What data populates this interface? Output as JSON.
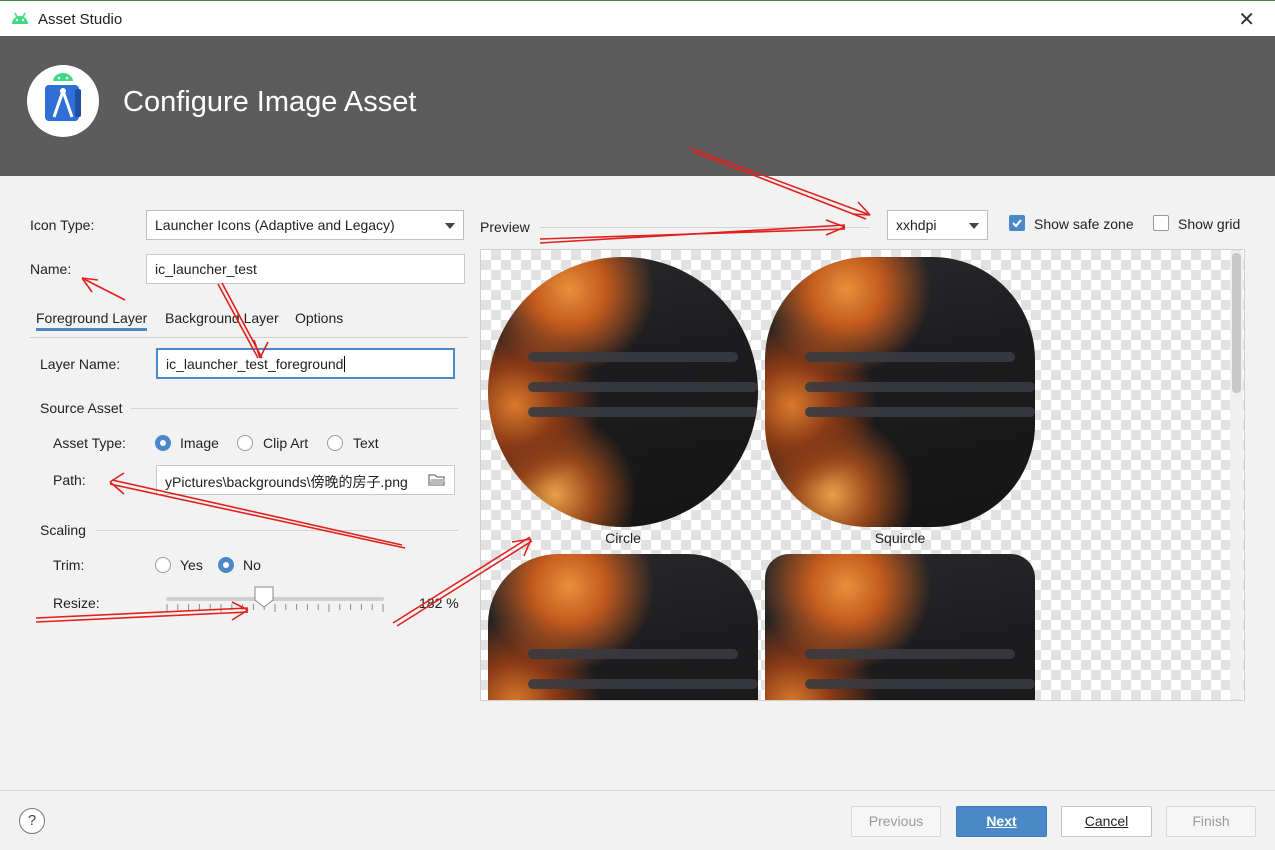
{
  "window": {
    "title": "Asset Studio"
  },
  "header": {
    "heading": "Configure Image Asset"
  },
  "form": {
    "icon_type_label": "Icon Type:",
    "icon_type_value": "Launcher Icons (Adaptive and Legacy)",
    "name_label": "Name:",
    "name_value": "ic_launcher_test",
    "tabs": [
      "Foreground Layer",
      "Background Layer",
      "Options"
    ],
    "layer_name_label": "Layer Name:",
    "layer_name_value": "ic_launcher_test_foreground",
    "source_asset_title": "Source Asset",
    "asset_type_label": "Asset Type:",
    "asset_type_options": [
      "Image",
      "Clip Art",
      "Text"
    ],
    "asset_type_selected": "Image",
    "path_label": "Path:",
    "path_value": "yPictures\\backgrounds\\傍晚的房子.png",
    "scaling_title": "Scaling",
    "trim_label": "Trim:",
    "trim_options": [
      "Yes",
      "No"
    ],
    "trim_selected": "No",
    "resize_label": "Resize:",
    "resize_value": "182 %",
    "resize_fraction": 0.45
  },
  "preview": {
    "label": "Preview",
    "density_value": "xxhdpi",
    "show_safe_zone_label": "Show safe zone",
    "show_safe_zone_checked": true,
    "show_grid_label": "Show grid",
    "show_grid_checked": false,
    "shapes": [
      "Circle",
      "Squircle"
    ]
  },
  "footer": {
    "help_label": "?",
    "previous_label": "Previous",
    "next_label": "Next",
    "cancel_label": "Cancel",
    "finish_label": "Finish"
  },
  "colors": {
    "accent": "#4a88c7",
    "header_bg": "#5c5c5c",
    "annotation_arrow": "#e0211e"
  }
}
